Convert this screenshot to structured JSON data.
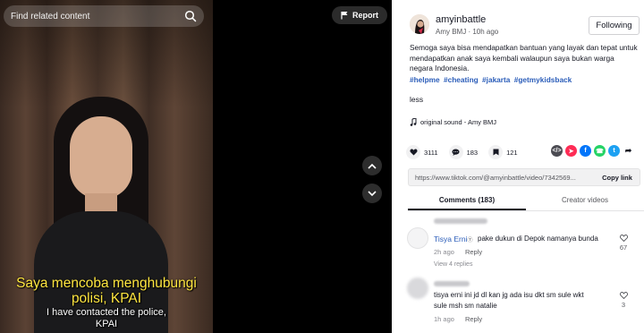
{
  "video": {
    "search_placeholder": "Find related content",
    "subtitle_id": "Saya mencoba menghubungi polisi, KPAI",
    "subtitle_en_line1": "I have contacted the police,",
    "subtitle_en_line2": "KPAI"
  },
  "middle": {
    "report_label": "Report"
  },
  "author": {
    "username": "amyinbattle",
    "display_meta": "Amy BMJ · 10h ago",
    "follow_label": "Following"
  },
  "post": {
    "description": "Semoga saya bisa mendapatkan bantuan yang layak dan tepat untuk mendapatkan anak saya kembali walaupun saya bukan warga negara Indonesia.",
    "hashtags": [
      "#helpme",
      "#cheating",
      "#jakarta",
      "#getmykidsback"
    ],
    "less_label": "less",
    "sound": "original sound - Amy BMJ"
  },
  "stats": {
    "likes": "3111",
    "comments": "183",
    "saves": "121"
  },
  "link": {
    "url": "https://www.tiktok.com/@amyinbattle/video/7342569...",
    "copy_label": "Copy link"
  },
  "tabs": {
    "comments": "Comments (183)",
    "creator": "Creator videos"
  },
  "comments": [
    {
      "name": "Tisya Erni",
      "text": "pake dukun di Depok namanya bunda",
      "time": "2h ago",
      "reply": "Reply",
      "likes": "67",
      "view_replies": "View 4 replies"
    },
    {
      "text_line1": "tisya erni ini jd dl kan jg ada isu dkt sm sule wkt",
      "text_line2": "sule msh sm natalie",
      "time": "1h ago",
      "reply": "Reply",
      "likes": "3"
    }
  ],
  "colors": {
    "hashtag": "#2b5db9",
    "subtitle_yellow": "#ffe640",
    "panel_bg": "#ffffff"
  }
}
